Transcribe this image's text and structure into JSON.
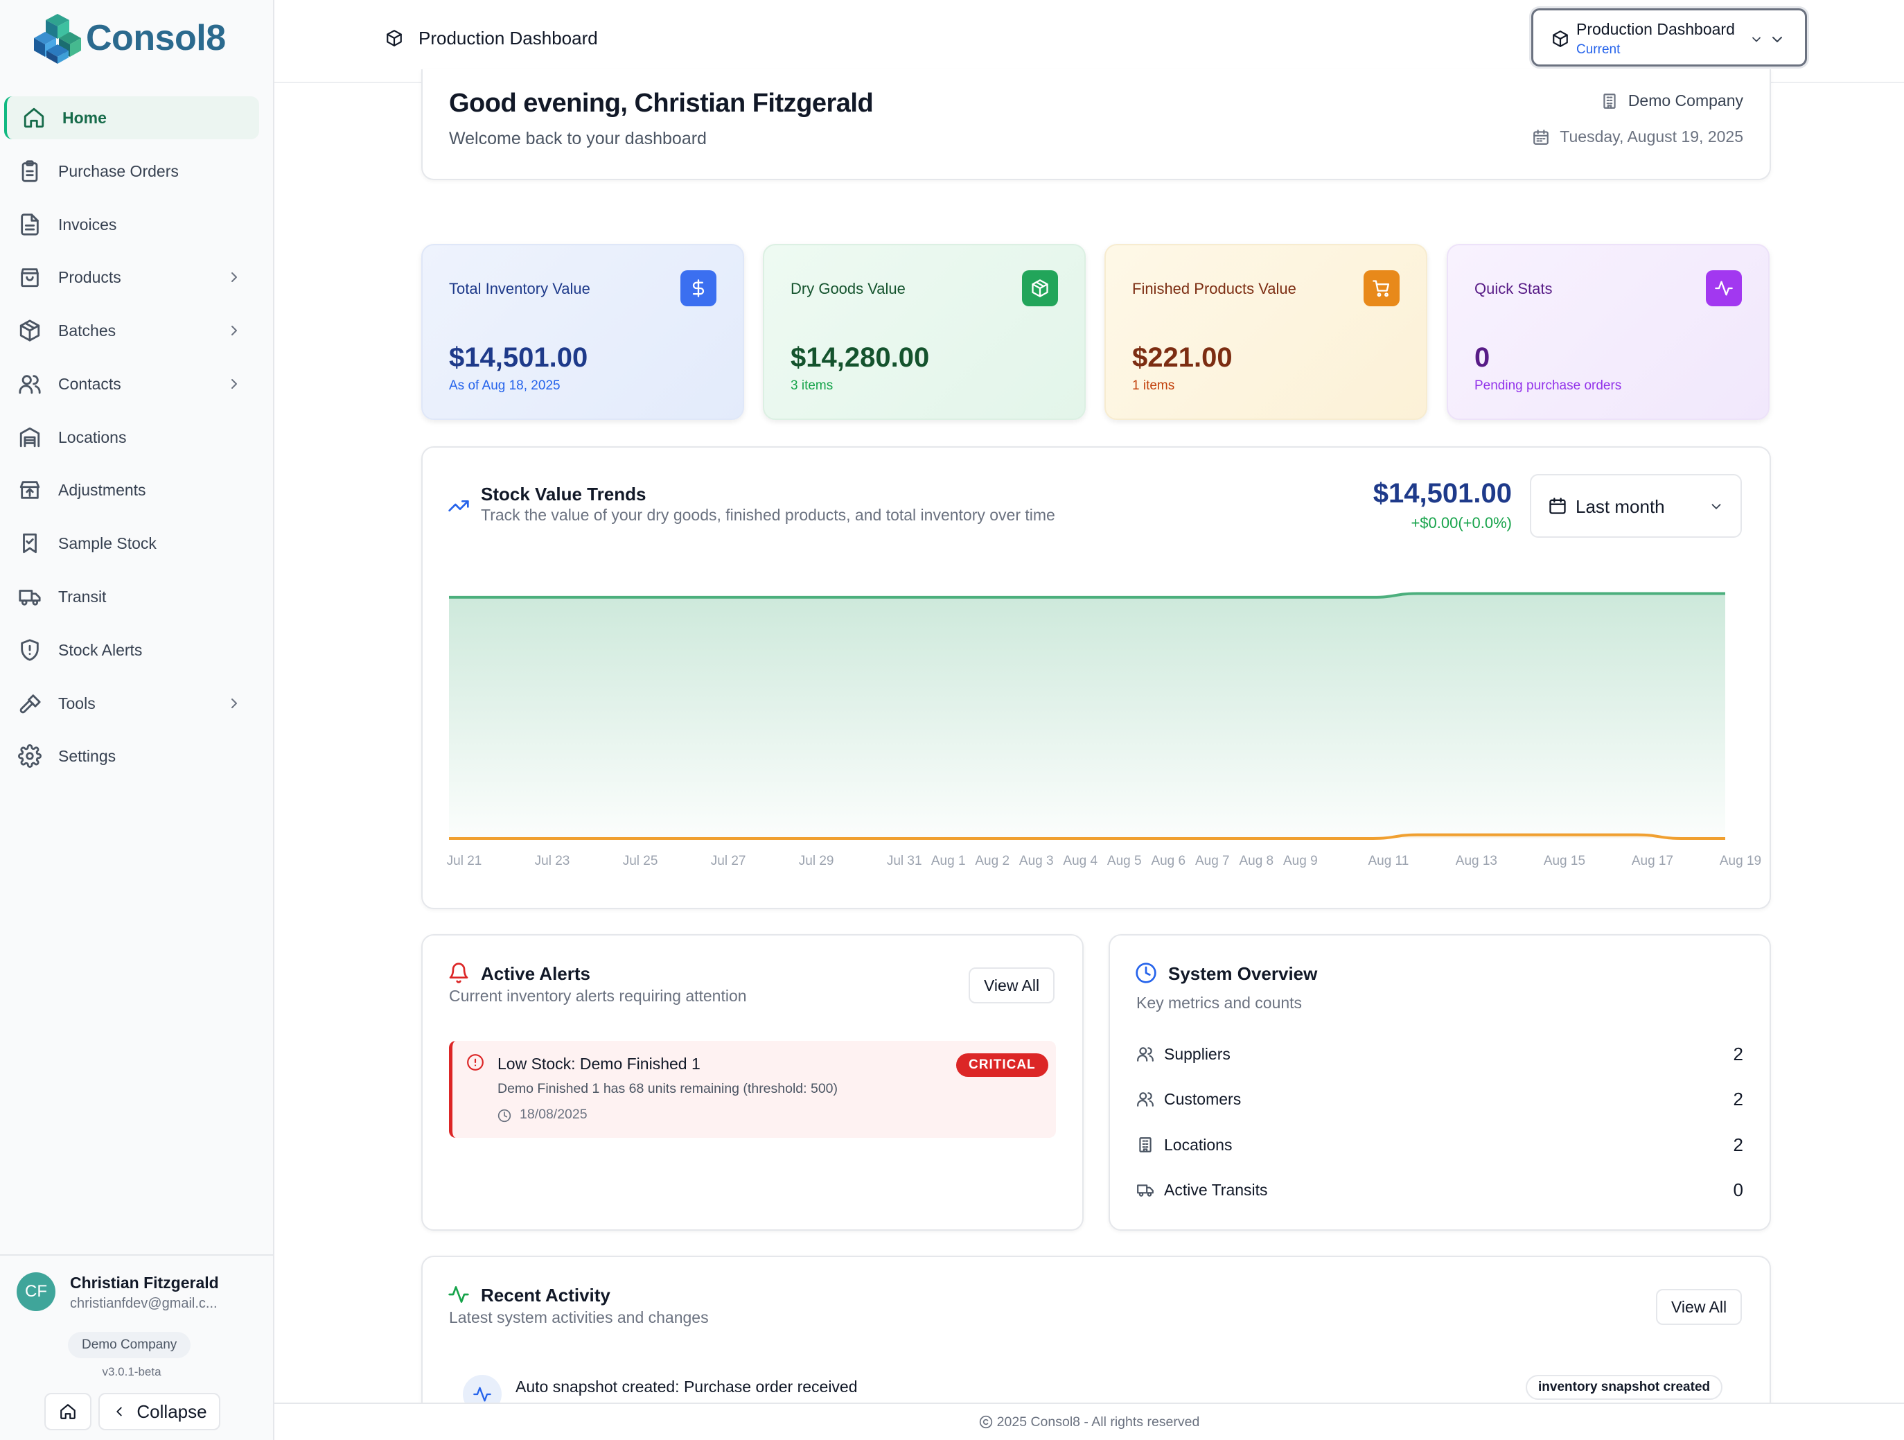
{
  "app": {
    "brand": "Consol8"
  },
  "sidebar": {
    "items": [
      {
        "label": "Home",
        "icon": "home-icon",
        "active": true
      },
      {
        "label": "Purchase Orders",
        "icon": "clipboard-icon"
      },
      {
        "label": "Invoices",
        "icon": "file-text-icon"
      },
      {
        "label": "Products",
        "icon": "shopping-bag-icon",
        "expandable": true
      },
      {
        "label": "Batches",
        "icon": "box-icon",
        "expandable": true
      },
      {
        "label": "Contacts",
        "icon": "users-icon",
        "expandable": true
      },
      {
        "label": "Locations",
        "icon": "warehouse-icon"
      },
      {
        "label": "Adjustments",
        "icon": "store-arrow-icon"
      },
      {
        "label": "Sample Stock",
        "icon": "bookmark-icon"
      },
      {
        "label": "Transit",
        "icon": "truck-icon"
      },
      {
        "label": "Stock Alerts",
        "icon": "shield-alert-icon"
      },
      {
        "label": "Tools",
        "icon": "hammer-icon",
        "expandable": true
      },
      {
        "label": "Settings",
        "icon": "gear-icon"
      }
    ],
    "user": {
      "initials": "CF",
      "name": "Christian Fitzgerald",
      "email": "christianfdev@gmail.c..."
    },
    "company": "Demo Company",
    "version": "v3.0.1-beta",
    "collapse_label": "Collapse"
  },
  "header": {
    "title": "Production Dashboard",
    "selector": {
      "name": "Production Dashboard",
      "status": "Current"
    }
  },
  "welcome": {
    "greeting": "Good evening, Christian Fitzgerald",
    "subtitle": "Welcome back to your dashboard",
    "company": "Demo Company",
    "date": "Tuesday, August 19, 2025"
  },
  "stats": [
    {
      "label": "Total Inventory Value",
      "value": "$14,501.00",
      "sub": "As of Aug 18, 2025",
      "icon": "dollar-icon",
      "accent": "#3b6ff0"
    },
    {
      "label": "Dry Goods Value",
      "value": "$14,280.00",
      "sub": "3 items",
      "icon": "package-icon",
      "accent": "#22a55a"
    },
    {
      "label": "Finished Products Value",
      "value": "$221.00",
      "sub": "1 items",
      "icon": "cart-icon",
      "accent": "#e8891a"
    },
    {
      "label": "Quick Stats",
      "value": "0",
      "sub": "Pending purchase orders",
      "icon": "activity-icon",
      "accent": "#a238f0"
    }
  ],
  "trend": {
    "title": "Stock Value Trends",
    "subtitle": "Track the value of your dry goods, finished products, and total inventory over time",
    "value": "$14,501.00",
    "change": "+$0.00(+0.0%)",
    "range": "Last month"
  },
  "chart_data": {
    "type": "area",
    "x": [
      "Jul 21",
      "Jul 22",
      "Jul 23",
      "Jul 24",
      "Jul 25",
      "Jul 26",
      "Jul 27",
      "Jul 28",
      "Jul 29",
      "Jul 30",
      "Jul 31",
      "Aug 1",
      "Aug 2",
      "Aug 3",
      "Aug 4",
      "Aug 5",
      "Aug 6",
      "Aug 7",
      "Aug 8",
      "Aug 9",
      "Aug 10",
      "Aug 11",
      "Aug 12",
      "Aug 13",
      "Aug 14",
      "Aug 15",
      "Aug 16",
      "Aug 17",
      "Aug 18",
      "Aug 19"
    ],
    "tick_labels": [
      "Jul 21",
      "Jul 23",
      "Jul 25",
      "Jul 27",
      "Jul 29",
      "Jul 31",
      "Aug 1",
      "Aug 2",
      "Aug 3",
      "Aug 4",
      "Aug 5",
      "Aug 6",
      "Aug 7",
      "Aug 8",
      "Aug 9",
      "Aug 11",
      "Aug 13",
      "Aug 15",
      "Aug 17",
      "Aug 19"
    ],
    "series": [
      {
        "color": "#4caf7d",
        "values": [
          14280,
          14280,
          14280,
          14280,
          14280,
          14280,
          14280,
          14280,
          14280,
          14280,
          14280,
          14280,
          14280,
          14280,
          14280,
          14280,
          14280,
          14280,
          14280,
          14280,
          14280,
          14280,
          14501,
          14501,
          14501,
          14501,
          14501,
          14501,
          14501,
          14501
        ]
      },
      {
        "color": "#f0a030",
        "values": [
          0,
          0,
          0,
          0,
          0,
          0,
          0,
          0,
          0,
          0,
          0,
          0,
          0,
          0,
          0,
          0,
          0,
          0,
          0,
          0,
          0,
          0,
          221,
          221,
          221,
          221,
          221,
          221,
          0,
          0
        ]
      }
    ],
    "ylim": [
      0,
      16000
    ],
    "grid": false,
    "legend": "none"
  },
  "alerts": {
    "title": "Active Alerts",
    "subtitle": "Current inventory alerts requiring attention",
    "view_all": "View All",
    "items": [
      {
        "title": "Low Stock: Demo Finished 1",
        "description": "Demo Finished 1 has 68 units remaining (threshold: 500)",
        "date": "18/08/2025",
        "severity": "CRITICAL"
      }
    ]
  },
  "overview": {
    "title": "System Overview",
    "subtitle": "Key metrics and counts",
    "rows": [
      {
        "label": "Suppliers",
        "value": "2",
        "icon": "users-icon"
      },
      {
        "label": "Customers",
        "value": "2",
        "icon": "users-icon"
      },
      {
        "label": "Locations",
        "value": "2",
        "icon": "building-icon"
      },
      {
        "label": "Active Transits",
        "value": "0",
        "icon": "truck-icon"
      }
    ]
  },
  "activity": {
    "title": "Recent Activity",
    "subtitle": "Latest system activities and changes",
    "view_all": "View All",
    "items": [
      {
        "title": "Auto snapshot created: Purchase order received",
        "badge": "inventory snapshot created"
      }
    ]
  },
  "footer": {
    "text": "2025 Consol8 - All rights reserved"
  }
}
